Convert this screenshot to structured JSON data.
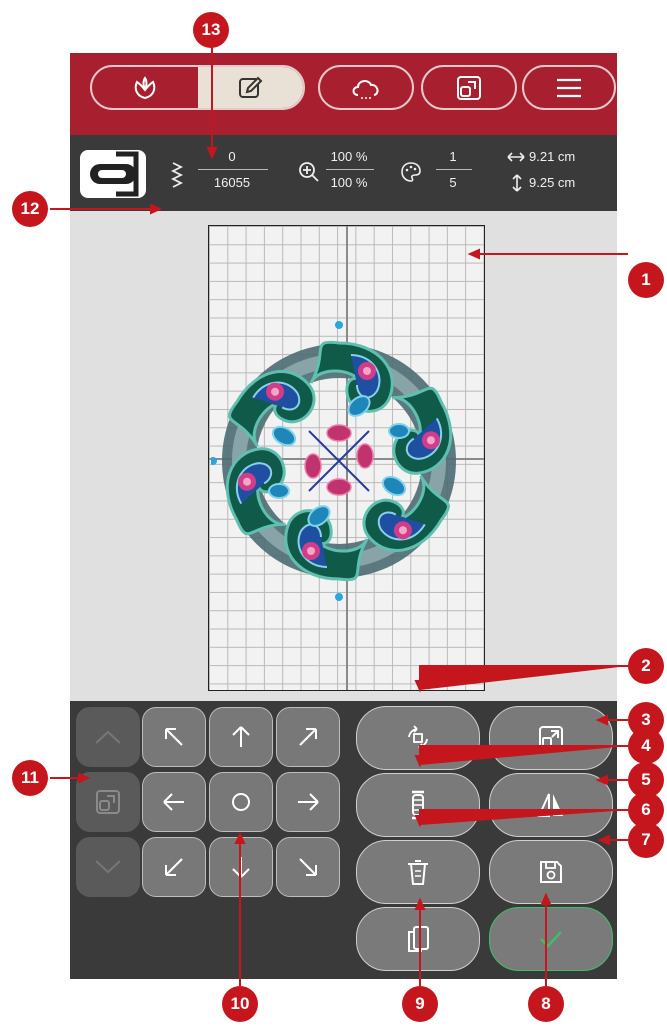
{
  "info": {
    "stitch_current": "0",
    "stitch_total": "16055",
    "zoom_top": "100 %",
    "zoom_bottom": "100 %",
    "color_current": "1",
    "color_total": "5",
    "width": "9.21 cm",
    "height": "9.25 cm"
  },
  "callouts": [
    "1",
    "2",
    "3",
    "4",
    "5",
    "6",
    "7",
    "8",
    "9",
    "10",
    "11",
    "12",
    "13"
  ],
  "colors": {
    "topbar": "#a82030",
    "panel": "#3a3a3a",
    "canvas": "#e0e0e0",
    "callout": "#c4161c",
    "ok_border": "#3cc06a"
  },
  "icons": {
    "top": [
      "embroidery-icon",
      "edit-icon",
      "cloud-icon",
      "hoop-icon",
      "menu-icon"
    ],
    "keypad": [
      "up-left-arrow-icon",
      "up-arrow-icon",
      "up-right-arrow-icon",
      "left-arrow-icon",
      "center-icon",
      "right-arrow-icon",
      "down-left-arrow-icon",
      "down-arrow-icon",
      "down-right-arrow-icon"
    ],
    "actions": [
      "rotate-icon",
      "resize-icon",
      "thread-spool-icon",
      "mirror-icon",
      "delete-icon",
      "save-icon",
      "duplicate-icon",
      "confirm-check-icon"
    ]
  }
}
